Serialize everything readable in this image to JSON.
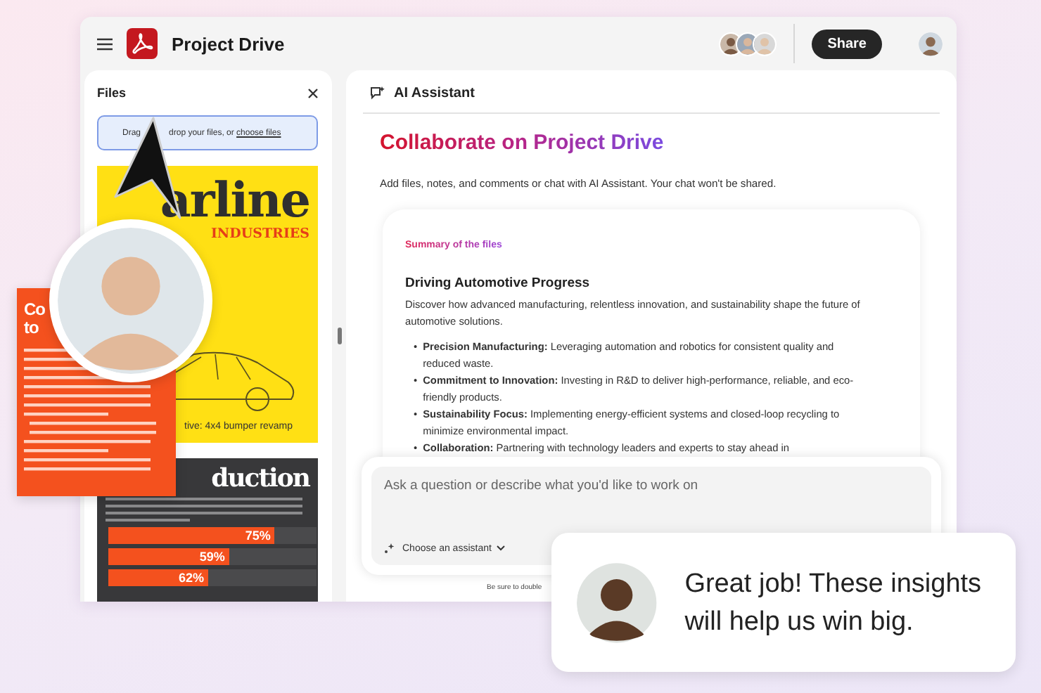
{
  "app": {
    "title": "Project Drive",
    "share": "Share"
  },
  "files": {
    "title": "Files",
    "drop_text": "Drag",
    "drop_text_2": "drop your files, or",
    "drop_link": "choose files",
    "thumbnails": [
      {
        "kind": "cover",
        "title": "arline",
        "subtitle": "INDUSTRIES",
        "caption": "tive: 4x4 bumper revamp"
      },
      {
        "kind": "report",
        "title": "duction",
        "bars": [
          {
            "level": 0.8,
            "reading": "75%"
          },
          {
            "level": 0.58,
            "reading": "59%"
          },
          {
            "level": 0.48,
            "reading": "62%"
          }
        ]
      }
    ]
  },
  "assistant": {
    "title": "AI Assistant",
    "heading": "Collaborate on Project Drive",
    "intro": "Add files, notes, and comments or chat with AI Assistant. Your chat won't be shared.",
    "summary": {
      "label": "Summary of the files",
      "title": "Driving Automotive Progress",
      "text": "Discover how advanced manufacturing, relentless innovation, and sustainability shape the future of automotive solutions.",
      "bullets": [
        {
          "marker": "•",
          "text": "**Precision Manufacturing:** Leveraging automation and robotics for consistent quality and reduced waste."
        },
        {
          "marker": "•",
          "text": "**Commitment to Innovation:** Investing in R&D to deliver high-performance, reliable, and eco-friendly products."
        },
        {
          "marker": "•",
          "text": "**Sustainability Focus:** Implementing energy-efficient systems and closed-loop recycling to minimize environmental impact."
        },
        {
          "marker": "•",
          "text": "**Collaboration:** Partnering with technology leaders and experts to stay ahead in"
        }
      ]
    },
    "input": {
      "placeholder": "Ask a question or describe what you'd like to work on",
      "assistant_menu": "Choose an assistant"
    },
    "disclaimer": "Be sure to double"
  },
  "overlays": {
    "document_heading": [
      "Co",
      "to"
    ],
    "chat_message": "Great job! These insights will help us win big."
  }
}
